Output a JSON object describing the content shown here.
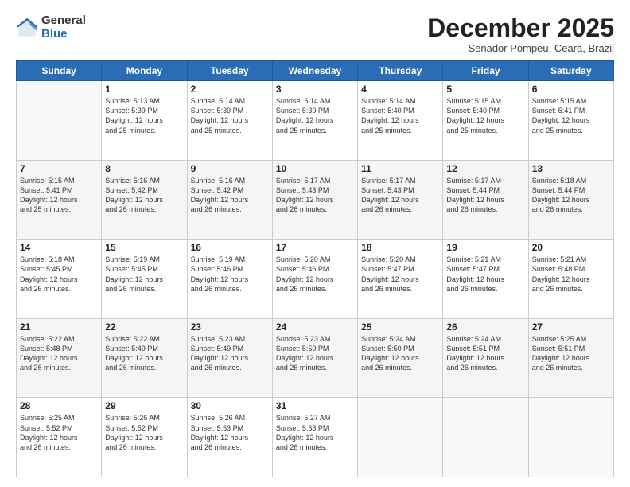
{
  "logo": {
    "general": "General",
    "blue": "Blue"
  },
  "header": {
    "month_title": "December 2025",
    "location": "Senador Pompeu, Ceara, Brazil"
  },
  "days_of_week": [
    "Sunday",
    "Monday",
    "Tuesday",
    "Wednesday",
    "Thursday",
    "Friday",
    "Saturday"
  ],
  "weeks": [
    [
      {
        "day": "",
        "info": ""
      },
      {
        "day": "1",
        "info": "Sunrise: 5:13 AM\nSunset: 5:39 PM\nDaylight: 12 hours\nand 25 minutes."
      },
      {
        "day": "2",
        "info": "Sunrise: 5:14 AM\nSunset: 5:39 PM\nDaylight: 12 hours\nand 25 minutes."
      },
      {
        "day": "3",
        "info": "Sunrise: 5:14 AM\nSunset: 5:39 PM\nDaylight: 12 hours\nand 25 minutes."
      },
      {
        "day": "4",
        "info": "Sunrise: 5:14 AM\nSunset: 5:40 PM\nDaylight: 12 hours\nand 25 minutes."
      },
      {
        "day": "5",
        "info": "Sunrise: 5:15 AM\nSunset: 5:40 PM\nDaylight: 12 hours\nand 25 minutes."
      },
      {
        "day": "6",
        "info": "Sunrise: 5:15 AM\nSunset: 5:41 PM\nDaylight: 12 hours\nand 25 minutes."
      }
    ],
    [
      {
        "day": "7",
        "info": "Sunrise: 5:15 AM\nSunset: 5:41 PM\nDaylight: 12 hours\nand 25 minutes."
      },
      {
        "day": "8",
        "info": "Sunrise: 5:16 AM\nSunset: 5:42 PM\nDaylight: 12 hours\nand 26 minutes."
      },
      {
        "day": "9",
        "info": "Sunrise: 5:16 AM\nSunset: 5:42 PM\nDaylight: 12 hours\nand 26 minutes."
      },
      {
        "day": "10",
        "info": "Sunrise: 5:17 AM\nSunset: 5:43 PM\nDaylight: 12 hours\nand 26 minutes."
      },
      {
        "day": "11",
        "info": "Sunrise: 5:17 AM\nSunset: 5:43 PM\nDaylight: 12 hours\nand 26 minutes."
      },
      {
        "day": "12",
        "info": "Sunrise: 5:17 AM\nSunset: 5:44 PM\nDaylight: 12 hours\nand 26 minutes."
      },
      {
        "day": "13",
        "info": "Sunrise: 5:18 AM\nSunset: 5:44 PM\nDaylight: 12 hours\nand 26 minutes."
      }
    ],
    [
      {
        "day": "14",
        "info": "Sunrise: 5:18 AM\nSunset: 5:45 PM\nDaylight: 12 hours\nand 26 minutes."
      },
      {
        "day": "15",
        "info": "Sunrise: 5:19 AM\nSunset: 5:45 PM\nDaylight: 12 hours\nand 26 minutes."
      },
      {
        "day": "16",
        "info": "Sunrise: 5:19 AM\nSunset: 5:46 PM\nDaylight: 12 hours\nand 26 minutes."
      },
      {
        "day": "17",
        "info": "Sunrise: 5:20 AM\nSunset: 5:46 PM\nDaylight: 12 hours\nand 26 minutes."
      },
      {
        "day": "18",
        "info": "Sunrise: 5:20 AM\nSunset: 5:47 PM\nDaylight: 12 hours\nand 26 minutes."
      },
      {
        "day": "19",
        "info": "Sunrise: 5:21 AM\nSunset: 5:47 PM\nDaylight: 12 hours\nand 26 minutes."
      },
      {
        "day": "20",
        "info": "Sunrise: 5:21 AM\nSunset: 5:48 PM\nDaylight: 12 hours\nand 26 minutes."
      }
    ],
    [
      {
        "day": "21",
        "info": "Sunrise: 5:22 AM\nSunset: 5:48 PM\nDaylight: 12 hours\nand 26 minutes."
      },
      {
        "day": "22",
        "info": "Sunrise: 5:22 AM\nSunset: 5:49 PM\nDaylight: 12 hours\nand 26 minutes."
      },
      {
        "day": "23",
        "info": "Sunrise: 5:23 AM\nSunset: 5:49 PM\nDaylight: 12 hours\nand 26 minutes."
      },
      {
        "day": "24",
        "info": "Sunrise: 5:23 AM\nSunset: 5:50 PM\nDaylight: 12 hours\nand 26 minutes."
      },
      {
        "day": "25",
        "info": "Sunrise: 5:24 AM\nSunset: 5:50 PM\nDaylight: 12 hours\nand 26 minutes."
      },
      {
        "day": "26",
        "info": "Sunrise: 5:24 AM\nSunset: 5:51 PM\nDaylight: 12 hours\nand 26 minutes."
      },
      {
        "day": "27",
        "info": "Sunrise: 5:25 AM\nSunset: 5:51 PM\nDaylight: 12 hours\nand 26 minutes."
      }
    ],
    [
      {
        "day": "28",
        "info": "Sunrise: 5:25 AM\nSunset: 5:52 PM\nDaylight: 12 hours\nand 26 minutes."
      },
      {
        "day": "29",
        "info": "Sunrise: 5:26 AM\nSunset: 5:52 PM\nDaylight: 12 hours\nand 26 minutes."
      },
      {
        "day": "30",
        "info": "Sunrise: 5:26 AM\nSunset: 5:53 PM\nDaylight: 12 hours\nand 26 minutes."
      },
      {
        "day": "31",
        "info": "Sunrise: 5:27 AM\nSunset: 5:53 PM\nDaylight: 12 hours\nand 26 minutes."
      },
      {
        "day": "",
        "info": ""
      },
      {
        "day": "",
        "info": ""
      },
      {
        "day": "",
        "info": ""
      }
    ]
  ]
}
